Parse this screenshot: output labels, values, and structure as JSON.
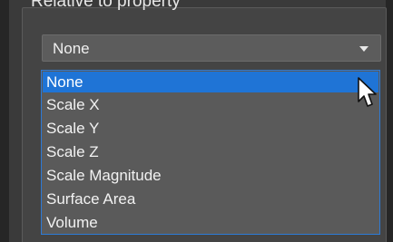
{
  "panel": {
    "group_title": "Relative to property"
  },
  "combo": {
    "selected_value": "None",
    "arrow_icon": "chevron-down-icon"
  },
  "dropdown": {
    "options": [
      {
        "label": "None",
        "selected": true
      },
      {
        "label": "Scale X",
        "selected": false
      },
      {
        "label": "Scale Y",
        "selected": false
      },
      {
        "label": "Scale Z",
        "selected": false
      },
      {
        "label": "Scale Magnitude",
        "selected": false
      },
      {
        "label": "Surface Area",
        "selected": false
      },
      {
        "label": "Volume",
        "selected": false
      }
    ]
  },
  "colors": {
    "selection": "#1f74d6",
    "dropdown_border": "#2d7ad6",
    "background": "#3a3a3a"
  },
  "cursor": {
    "icon": "mouse-pointer-icon"
  }
}
